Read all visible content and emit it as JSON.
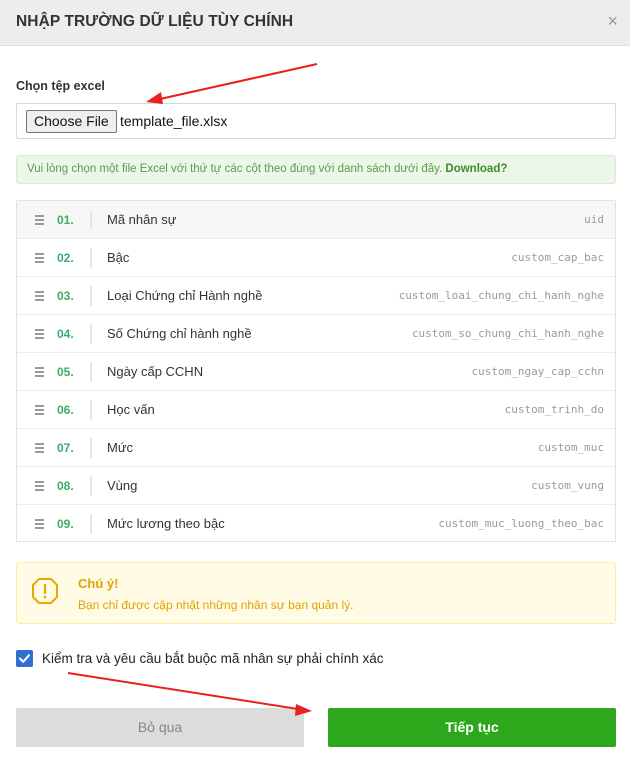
{
  "dialog": {
    "title": "NHẬP TRƯỜNG DỮ LIỆU TÙY CHÍNH",
    "close": "×"
  },
  "file": {
    "label": "Chọn tệp excel",
    "button": "Choose File",
    "filename": "template_file.xlsx"
  },
  "notice": {
    "text": "Vui lòng chọn một file Excel với thứ tự các cột theo đúng với danh sách dưới đây. ",
    "link": "Download?"
  },
  "fields": [
    {
      "num": "01.",
      "name": "Mã nhân sự",
      "key": "uid"
    },
    {
      "num": "02.",
      "name": "Bậc",
      "key": "custom_cap_bac"
    },
    {
      "num": "03.",
      "name": "Loại Chứng chỉ Hành nghề",
      "key": "custom_loai_chung_chi_hanh_nghe"
    },
    {
      "num": "04.",
      "name": "Số Chứng chỉ hành nghề",
      "key": "custom_so_chung_chi_hanh_nghe"
    },
    {
      "num": "05.",
      "name": "Ngày cấp CCHN",
      "key": "custom_ngay_cap_cchn"
    },
    {
      "num": "06.",
      "name": "Học vấn",
      "key": "custom_trinh_do"
    },
    {
      "num": "07.",
      "name": "Mức",
      "key": "custom_muc"
    },
    {
      "num": "08.",
      "name": "Vùng",
      "key": "custom_vung"
    },
    {
      "num": "09.",
      "name": "Mức lương theo bậc",
      "key": "custom_muc_luong_theo_bac"
    }
  ],
  "warning": {
    "title": "Chú ý!",
    "text": "Bạn chỉ được cập nhật những nhân sự bạn quản lý.",
    "icon": "warning-icon"
  },
  "checkbox": {
    "label": "Kiểm tra và yêu cầu bắt buộc mã nhân sự phải chính xác",
    "checked": true
  },
  "buttons": {
    "skip": "Bỏ qua",
    "next": "Tiếp tục"
  },
  "colors": {
    "accent_green": "#2da81c",
    "number_green": "#3dab6a",
    "checkbox_blue": "#2f6fcf",
    "warning_amber": "#e3a200",
    "annotation_red": "#e8211c"
  }
}
